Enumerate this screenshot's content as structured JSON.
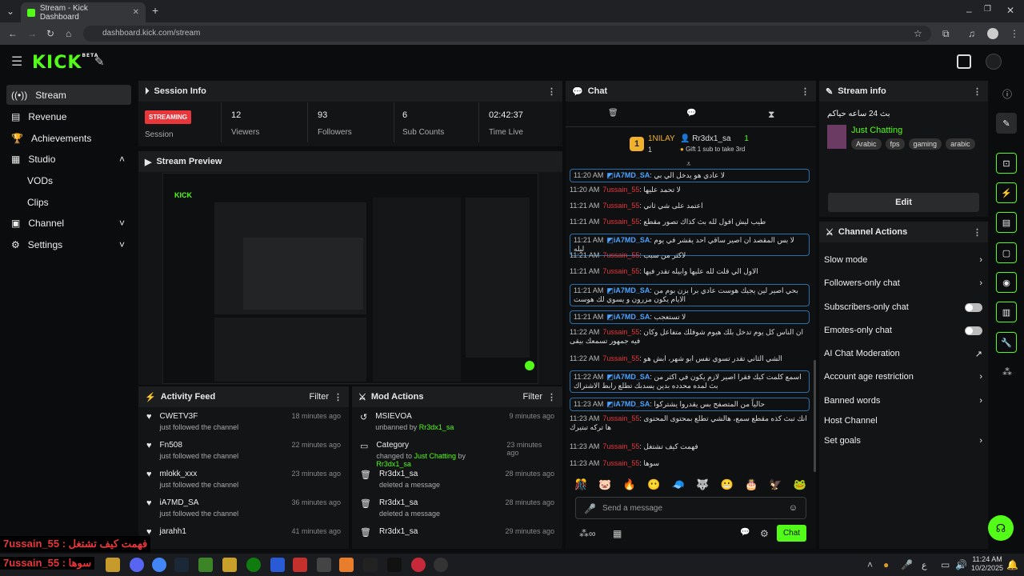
{
  "browser": {
    "tab_title": "Stream - Kick Dashboard",
    "url": "dashboard.kick.com/stream"
  },
  "header": {
    "logo": "KICK",
    "beta": "BETA"
  },
  "sidebar": {
    "items": [
      {
        "label": "Stream",
        "icon": "broadcast-icon"
      },
      {
        "label": "Revenue",
        "icon": "revenue-icon"
      },
      {
        "label": "Achievements",
        "icon": "trophy-icon"
      },
      {
        "label": "Studio",
        "icon": "studio-icon"
      },
      {
        "label": "VODs"
      },
      {
        "label": "Clips"
      },
      {
        "label": "Channel",
        "icon": "channel-icon"
      },
      {
        "label": "Settings",
        "icon": "gear-icon"
      }
    ]
  },
  "session": {
    "title": "Session Info",
    "badge": "STREAMING",
    "badge_sub": "Session",
    "stats": [
      {
        "v": "12",
        "l": "Viewers"
      },
      {
        "v": "93",
        "l": "Followers"
      },
      {
        "v": "6",
        "l": "Sub Counts"
      },
      {
        "v": "02:42:37",
        "l": "Time Live"
      }
    ]
  },
  "preview": {
    "title": "Stream Preview"
  },
  "activity": {
    "title": "Activity Feed",
    "filter": "Filter",
    "rows": [
      {
        "name": "CWETV3F",
        "sub": "just followed the channel",
        "time": "18 minutes ago"
      },
      {
        "name": "Fn508",
        "sub": "just followed the channel",
        "time": "22 minutes ago"
      },
      {
        "name": "mlokk_xxx",
        "sub": "just followed the channel",
        "time": "23 minutes ago"
      },
      {
        "name": "iA7MD_SA",
        "sub": "just followed the channel",
        "time": "36 minutes ago"
      },
      {
        "name": "jarahh1",
        "sub": "",
        "time": "41 minutes ago"
      }
    ]
  },
  "mod": {
    "title": "Mod Actions",
    "filter": "Filter",
    "rows": [
      {
        "name": "MSIEVOA",
        "sub": "unbanned by",
        "who": "Rr3dx1_sa",
        "time": "9 minutes ago"
      },
      {
        "name": "Category",
        "sub": "changed to",
        "cat": "Just Chatting",
        "by": "by",
        "who": "Rr3dx1_sa",
        "time": "23 minutes ago"
      },
      {
        "name": "Rr3dx1_sa",
        "sub": "deleted a message",
        "time": "28 minutes ago"
      },
      {
        "name": "Rr3dx1_sa",
        "sub": "deleted a message",
        "time": "28 minutes ago"
      },
      {
        "name": "Rr3dx1_sa",
        "sub": "",
        "time": "29 minutes ago"
      }
    ]
  },
  "chat": {
    "title": "Chat",
    "leader": {
      "rank": "1",
      "user1": "1NILAY",
      "n1": "1",
      "user2": "Rr3dx1_sa",
      "n2": "1",
      "gift": "Gift 1 sub to take 3rd"
    },
    "messages": [
      {
        "t": "11:20 AM",
        "u": "iA7MD_SA",
        "m": "لا عادي هو يدخل الي بي",
        "hl": true
      },
      {
        "t": "11:20 AM",
        "u": "7ussain_55",
        "m": "لا تحمد عليها"
      },
      {
        "t": "11:21 AM",
        "u": "7ussain_55",
        "m": "اعتمد على شي ثاني"
      },
      {
        "t": "11:21 AM",
        "u": "7ussain_55",
        "m": "طيب ليش افول لله بث كذاك تصور مقطع"
      },
      {
        "t": "11:21 AM",
        "u": "iA7MD_SA",
        "m": "لا بس المقصد ان اصير ساقي احد يقشر في يوم ليله",
        "hl": true
      },
      {
        "t": "11:21 AM",
        "u": "7ussain_55",
        "m": "لاكثر من سبب"
      },
      {
        "t": "11:21 AM",
        "u": "7ussain_55",
        "m": "الاول الي قلت لله عليها وابيله تقدر فيها"
      },
      {
        "t": "11:21 AM",
        "u": "iA7MD_SA",
        "m": "بحي اصير لين يجيك هوست عادي برا بزن بوم من الايام يكون مزرون و يسوي لك هوست",
        "hl": true
      },
      {
        "t": "11:21 AM",
        "u": "iA7MD_SA",
        "m": "لا تستعجب",
        "hl": true
      },
      {
        "t": "11:22 AM",
        "u": "7ussain_55",
        "m": "ان الناس كل يوم تدخل بلك هيوم شوفلك متفاعل وكان فيه جمهور تسمعك بيقى"
      },
      {
        "t": "11:22 AM",
        "u": "7ussain_55",
        "m": "الشي الثاني تقدر تسوي نفس ابو شهر، ابش هو"
      },
      {
        "t": "11:22 AM",
        "u": "iA7MD_SA",
        "m": "اسمع كلمت كيك فقرا اصير لازم يكون في اكثر من بث لمده محدده بدين يسدبك تطلع رابط الاشتراك",
        "hl": true
      },
      {
        "t": "11:23 AM",
        "u": "iA7MD_SA",
        "m": "حالياً من المتصفح بس يقدروا يشتركوا",
        "hl": true
      },
      {
        "t": "11:23 AM",
        "u": "7ussain_55",
        "m": "انك تبث كذه مقطع سمع، هالشي تطلع بمحتوى المحتوى ها تركه تبتيرك"
      },
      {
        "t": "11:23 AM",
        "u": "7ussain_55",
        "m": "فهمت كيف تشتغل"
      },
      {
        "t": "11:23 AM",
        "u": "7ussain_55",
        "m": "سوها"
      }
    ],
    "input_placeholder": "Send a message",
    "send": "Chat"
  },
  "stream_info": {
    "title": "Stream info",
    "stream_title": "بث 24 ساعه حياكم",
    "category": "Just Chatting",
    "tags": [
      "Arabic",
      "fps",
      "gaming",
      "arabic"
    ],
    "edit": "Edit"
  },
  "channel_actions": {
    "title": "Channel Actions",
    "items": [
      {
        "label": "Slow mode",
        "ctl": "chevron"
      },
      {
        "label": "Followers-only chat",
        "ctl": "chevron"
      },
      {
        "label": "Subscribers-only chat",
        "ctl": "toggle"
      },
      {
        "label": "Emotes-only chat",
        "ctl": "toggle"
      },
      {
        "label": "AI Chat Moderation",
        "ctl": "link"
      },
      {
        "label": "Account age restriction",
        "ctl": "chevron"
      },
      {
        "label": "Banned words",
        "ctl": "chevron"
      },
      {
        "label": "Host Channel",
        "ctl": "none"
      },
      {
        "label": "Set goals",
        "ctl": "chevron"
      }
    ]
  },
  "overlay": {
    "line1": "7ussain_55 : فهمت كيف تشتغل",
    "line2": "7ussain_55 : سوها"
  },
  "taskbar": {
    "time": "11:24 AM",
    "date": "10/2/2025",
    "lang": "ع"
  },
  "colors": {
    "accent": "#53fc18",
    "bg": "#0b0c0d",
    "panel": "#131416",
    "red": "#e8363b"
  }
}
